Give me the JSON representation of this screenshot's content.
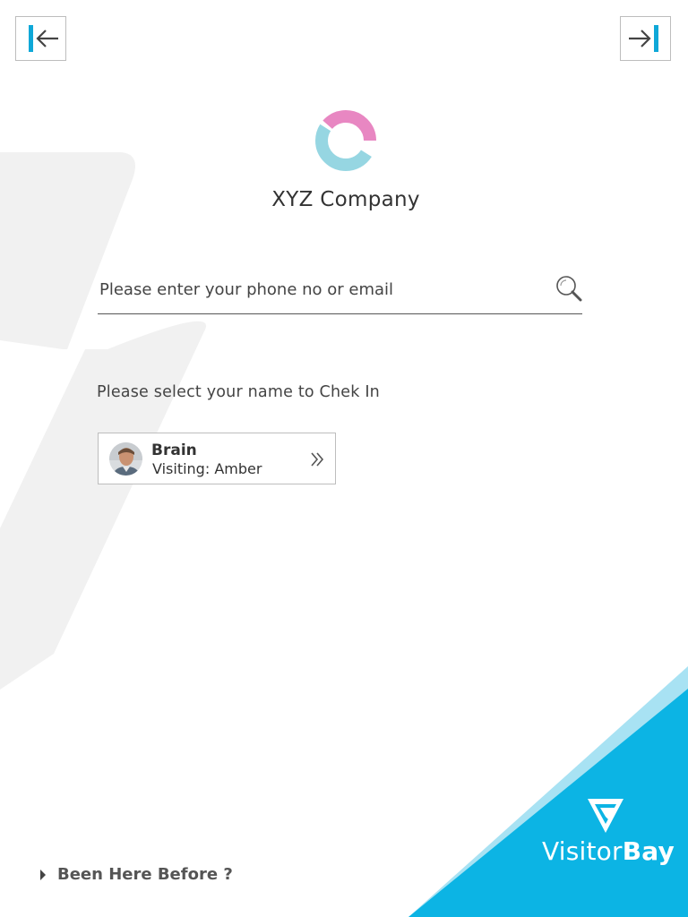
{
  "header": {
    "back_icon": "arrow-left-to-bar-icon",
    "forward_icon": "arrow-right-to-bar-icon"
  },
  "company": {
    "name": "XYZ Company",
    "logo_colors": [
      "#e887c2",
      "#96d6e2"
    ]
  },
  "search": {
    "placeholder": "Please enter your phone no or email",
    "value": "",
    "icon": "search-icon"
  },
  "instruction": "Please select your name to Chek In",
  "visitors": [
    {
      "name": "Brain",
      "subtitle": "Visiting: Amber"
    }
  ],
  "footer": {
    "been_here_label": "Been Here Before ?"
  },
  "brand": {
    "name_part1": "Visitor",
    "name_part2": "Bay",
    "colors": {
      "primary": "#0cb4e4",
      "light": "#a8e2f3"
    }
  },
  "colors": {
    "accent": "#0fa8d8",
    "border": "#bdbdbd",
    "text": "#333333",
    "watermark": "#f1f1f1"
  }
}
